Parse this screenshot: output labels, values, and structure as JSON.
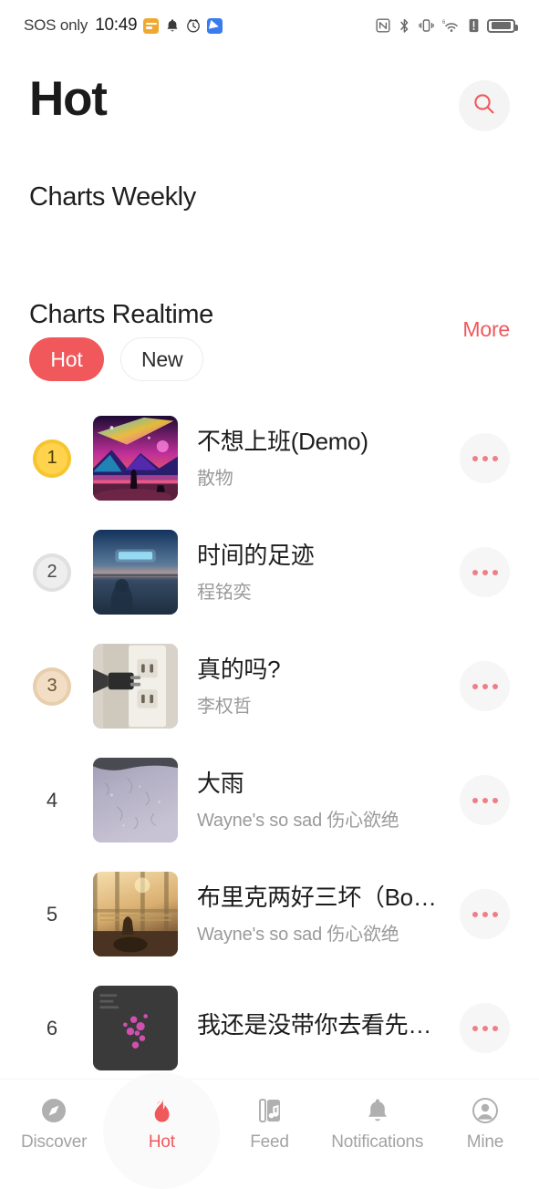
{
  "statusbar": {
    "carrier": "SOS only",
    "time": "10:49",
    "left_icons": [
      "wallet-icon",
      "bell-icon",
      "clock-icon",
      "app-icon"
    ],
    "right_icons": [
      "nfc-icon",
      "bluetooth-icon",
      "vibrate-icon",
      "wifi-icon",
      "alert-icon",
      "battery-icon"
    ],
    "wifi_label": "6"
  },
  "header": {
    "title": "Hot",
    "search_icon": "search-icon"
  },
  "sections": {
    "weekly_title": "Charts Weekly",
    "realtime_title": "Charts Realtime",
    "more_label": "More"
  },
  "chips": [
    {
      "label": "Hot",
      "active": true
    },
    {
      "label": "New",
      "active": false
    }
  ],
  "tracks": [
    {
      "rank": "1",
      "badge": "gold",
      "title": "不想上班(Demo)",
      "artist": "散物",
      "cover": "cosmic-mountain",
      "menu": "more-options-icon"
    },
    {
      "rank": "2",
      "badge": "silver",
      "title": "时间的足迹",
      "artist": "程铭奕",
      "cover": "twilight-ocean",
      "menu": "more-options-icon"
    },
    {
      "rank": "3",
      "badge": "bronze",
      "title": "真的吗?",
      "artist": "李权哲",
      "cover": "wall-socket",
      "menu": "more-options-icon"
    },
    {
      "rank": "4",
      "badge": "none",
      "title": "大雨",
      "artist": "Wayne's so sad 伤心欲绝",
      "cover": "wet-glass",
      "menu": "more-options-icon"
    },
    {
      "rank": "5",
      "badge": "none",
      "title": "布里克两好三坏（Bonu…",
      "artist": "Wayne's so sad 伤心欲绝",
      "cover": "sunlit-window",
      "menu": "more-options-icon"
    },
    {
      "rank": "6",
      "badge": "none",
      "title": "我还是没带你去看先知…",
      "artist": "",
      "cover": "dark-blossom",
      "menu": "more-options-icon"
    }
  ],
  "bottom_nav": [
    {
      "label": "Discover",
      "icon": "compass-icon",
      "active": false
    },
    {
      "label": "Hot",
      "icon": "flame-icon",
      "active": true
    },
    {
      "label": "Feed",
      "icon": "music-book-icon",
      "active": false
    },
    {
      "label": "Notifications",
      "icon": "bell-icon",
      "active": false
    },
    {
      "label": "Mine",
      "icon": "person-icon",
      "active": false
    }
  ],
  "colors": {
    "accent": "#F0585C",
    "title_text": "#1b1b1b",
    "muted_text": "#9a9a9a",
    "nav_inactive": "#a3a3a3",
    "gold": "#FFD34D",
    "silver": "#eeeeee",
    "bronze": "#F2DEC4"
  }
}
